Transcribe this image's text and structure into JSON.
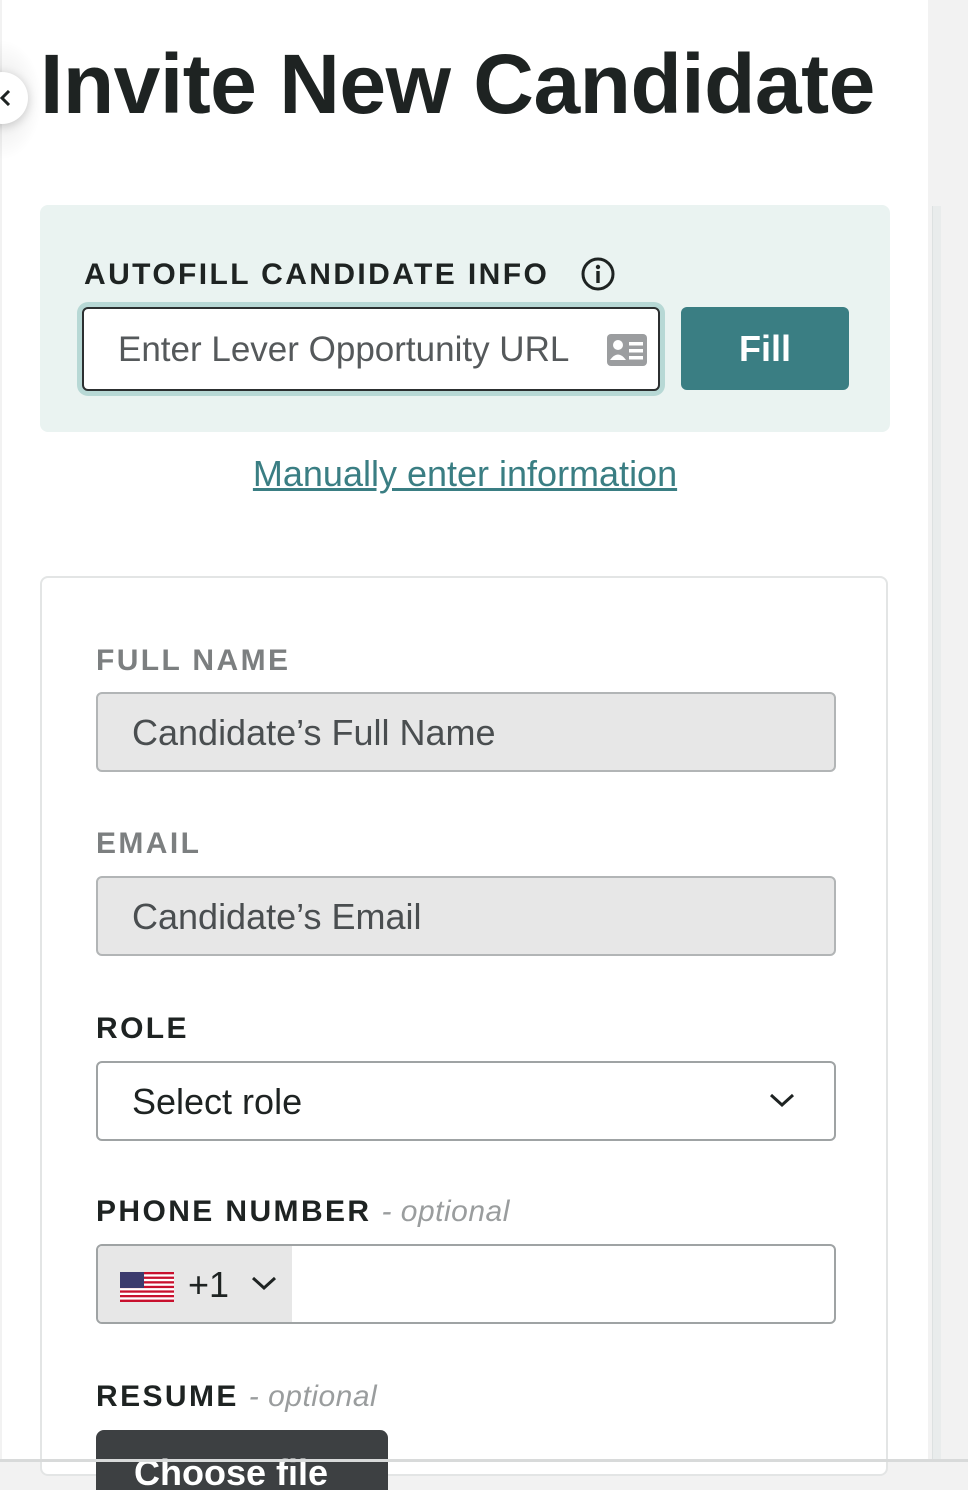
{
  "header": {
    "title": "Invite New Candidate"
  },
  "autofill": {
    "label": "AUTOFILL CANDIDATE INFO",
    "input_placeholder": "Enter Lever Opportunity URL",
    "input_value": "",
    "fill_button_label": "Fill",
    "info_icon": "info-circle-icon",
    "card_icon": "contact-card-icon"
  },
  "manual_link": "Manually enter information",
  "form": {
    "full_name": {
      "label": "FULL NAME",
      "placeholder": "Candidate’s Full Name"
    },
    "email": {
      "label": "EMAIL",
      "placeholder": "Candidate’s Email"
    },
    "role": {
      "label": "ROLE",
      "selected": "Select role"
    },
    "phone": {
      "label": "PHONE NUMBER",
      "optional_text": "- optional",
      "country_flag": "us-flag-icon",
      "country_code": "+1",
      "value": ""
    },
    "resume": {
      "label": "RESUME",
      "optional_text": "- optional",
      "button_label": "Choose file"
    }
  },
  "colors": {
    "accent": "#3a7e83",
    "autofill_bg": "#eaf3f1",
    "title_text": "#1e2322",
    "disabled_field_bg": "#e7e7e7"
  }
}
